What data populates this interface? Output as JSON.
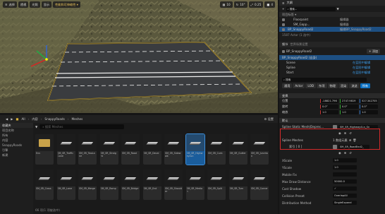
{
  "viewport": {
    "toolbar_left": [
      "选择",
      "透视",
      "光照",
      "显示"
    ],
    "toolbar_center_label": "性能和可伸缩性 ▾",
    "toolbar_right": [
      "10",
      "10°",
      "0.25",
      "4"
    ]
  },
  "content_browser": {
    "breadcrumb": [
      "All",
      "内容",
      "SnappyRoads",
      "Meshes"
    ],
    "settings_label": "设置",
    "search_placeholder": "搜索 Meshes",
    "sources": [
      "收藏夹",
      "项目名称",
      "所有",
      "内容",
      "SnappyRoads",
      "引擎",
      "新建"
    ],
    "tiles_row1": [
      {
        "label": "Env",
        "kind": "folder"
      },
      {
        "label": "SM_SR_TrafficCone",
        "kind": "mesh"
      },
      {
        "label": "SM_SR_TwoLane",
        "kind": "mesh"
      },
      {
        "label": "SM_SR_Straight",
        "kind": "mesh"
      },
      {
        "label": "SM_SR_Road",
        "kind": "mesh"
      },
      {
        "label": "SM_SR_Decal",
        "kind": "mesh"
      },
      {
        "label": "SM_SR_Sidewalk",
        "kind": "mesh"
      },
      {
        "label": "SM_SR_Highway4Ln",
        "kind": "mesh",
        "selected": true
      },
      {
        "label": "SM_SR_Curb",
        "kind": "mesh"
      },
      {
        "label": "SM_SR_Gutter",
        "kind": "mesh"
      },
      {
        "label": "SM_SR_Junction",
        "kind": "mesh"
      }
    ],
    "tiles_row2": [
      {
        "label": "SM_SR_Cross",
        "kind": "mesh"
      },
      {
        "label": "SM_SR_Lane",
        "kind": "mesh"
      },
      {
        "label": "SM_SR_Merge",
        "kind": "mesh"
      },
      {
        "label": "SM_SR_Ramp",
        "kind": "mesh"
      },
      {
        "label": "SM_SR_Bridge",
        "kind": "mesh"
      },
      {
        "label": "SM_SR_End",
        "kind": "mesh"
      },
      {
        "label": "SM_SR_Shoulder",
        "kind": "mesh"
      },
      {
        "label": "SM_SR_Median",
        "kind": "mesh"
      },
      {
        "label": "SM_SR_Split",
        "kind": "mesh"
      },
      {
        "label": "SM_SR_Turn",
        "kind": "mesh"
      },
      {
        "label": "SM_SR_Corner",
        "kind": "mesh"
      }
    ],
    "footer": "66 项(1 项被选中)"
  },
  "outliner": {
    "tab": "大纲",
    "search_placeholder": "搜索...",
    "header": "项目标签 ▾",
    "rows": [
      {
        "label": "Floorpaint",
        "type": "编辑器"
      },
      {
        "label": "SM_Gapp...",
        "type": "编辑器"
      },
      {
        "label": "BP_SnappyRoad2",
        "type": "编辑BP_SnappyRoad2",
        "selected": true
      }
    ],
    "count": "1587 Actor (1 选中)"
  },
  "details": {
    "tabs": [
      "细节",
      "世界场景设置"
    ],
    "actor_name": "BP_SnappyRoad2",
    "add_label": "+ 添加",
    "components": [
      {
        "label": "BP_SnappyRoad2 (自身)",
        "selected": true
      },
      {
        "label": "Scene",
        "edit": "在蓝图中编辑"
      },
      {
        "label": "Spline",
        "edit": "在蓝图中编辑"
      },
      {
        "label": "Start",
        "edit": "在蓝图中编辑"
      }
    ],
    "search_placeholder": "搜索",
    "category_tabs": [
      "通用",
      "Actor",
      "LOD",
      "杂项",
      "物理",
      "渲染",
      "流送",
      "所有"
    ],
    "transform_section": "变换",
    "transform": [
      {
        "label": "位置",
        "values": [
          "-18821.796",
          "2747.9819",
          "527.342705"
        ]
      },
      {
        "label": "旋转",
        "values": [
          "0.0°",
          "0.0°",
          "0.0°"
        ]
      },
      {
        "label": "缩放",
        "values": [
          "1.0",
          "1.0",
          "1.0"
        ]
      }
    ],
    "defaults_section": "默认",
    "spline_mesh_label": "Spline Static Mesh(Deprec...",
    "spline_mesh_value": "SM_SR_Highway4Ln_Sn",
    "spline_meshes_label": "Spline Meshes",
    "spline_meshes_value": "1 数组元素",
    "index_label": "索引 [ 0 ]",
    "index_value": "SM_SR_RoadEnd2_",
    "props": [
      {
        "label": "XScale",
        "value": "1.0"
      },
      {
        "label": "YScale",
        "value": "1.0"
      },
      {
        "label": "Mobile Fix",
        "value": ""
      },
      {
        "label": "Max Draw Distance",
        "value": "50000.0"
      },
      {
        "label": "Cast Shadow",
        "value": "✓"
      },
      {
        "label": "Collision Preset",
        "value": "OverlapAll"
      },
      {
        "label": "Distribution Method",
        "value": "SingleExpand"
      }
    ]
  },
  "colors": {
    "accent": "#0c70c2",
    "highlight_box": "#d42a2a"
  }
}
